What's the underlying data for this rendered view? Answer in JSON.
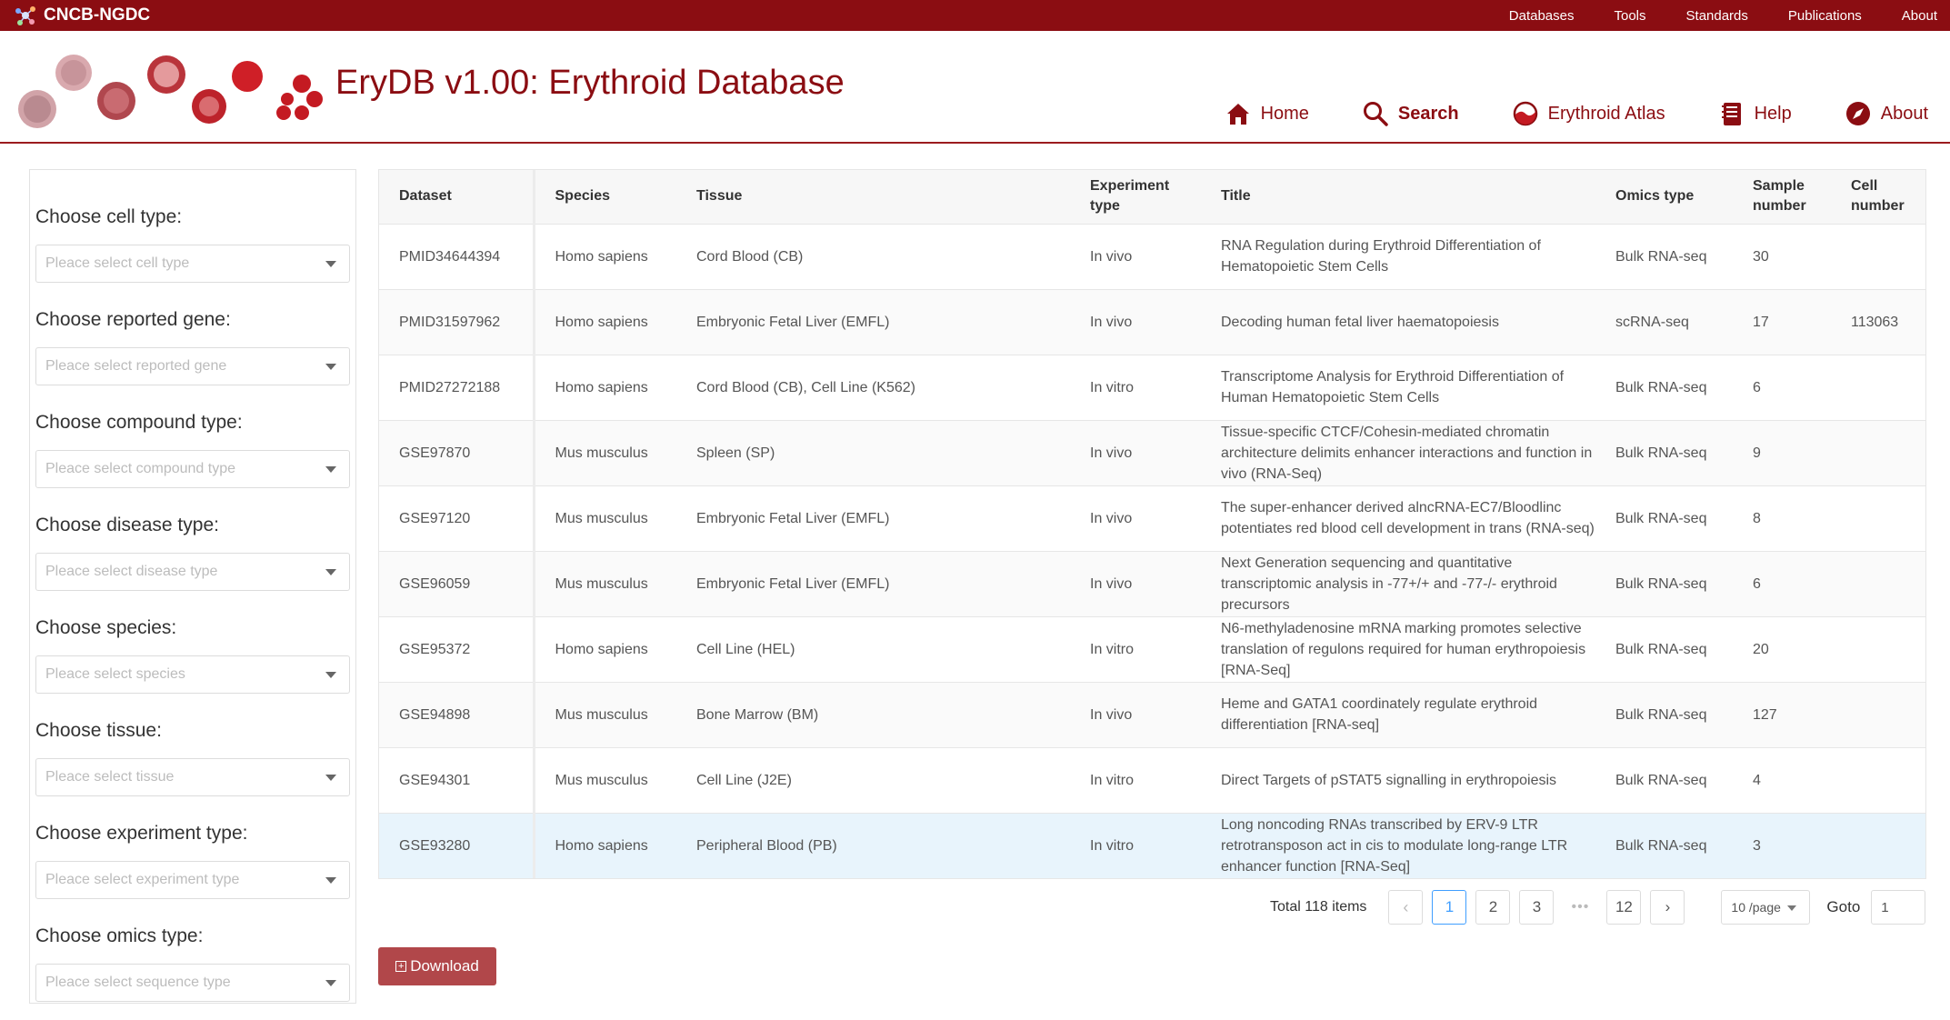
{
  "topbar": {
    "brand": "CNCB-NGDC",
    "nav": [
      "Databases",
      "Tools",
      "Standards",
      "Publications",
      "About"
    ]
  },
  "header": {
    "title": "EryDB v1.00: Erythroid Database",
    "nav": [
      {
        "label": "Home",
        "icon": "home-icon"
      },
      {
        "label": "Search",
        "icon": "search-icon"
      },
      {
        "label": "Erythroid Atlas",
        "icon": "atlas-icon"
      },
      {
        "label": "Help",
        "icon": "book-icon"
      },
      {
        "label": "About",
        "icon": "compass-icon"
      }
    ]
  },
  "filters": [
    {
      "label": "Choose cell type:",
      "placeholder": "Pleace select cell type"
    },
    {
      "label": "Choose reported gene:",
      "placeholder": "Pleace select reported gene"
    },
    {
      "label": "Choose compound type:",
      "placeholder": "Pleace select compound type"
    },
    {
      "label": "Choose disease type:",
      "placeholder": "Pleace select disease type"
    },
    {
      "label": "Choose species:",
      "placeholder": "Pleace select species"
    },
    {
      "label": "Choose tissue:",
      "placeholder": "Pleace select tissue"
    },
    {
      "label": "Choose experiment type:",
      "placeholder": "Pleace select experiment type"
    },
    {
      "label": "Choose omics type:",
      "placeholder": "Pleace select sequence type"
    }
  ],
  "table": {
    "headers": [
      "Dataset",
      "Species",
      "Tissue",
      "Experiment type",
      "Title",
      "Omics type",
      "Sample number",
      "Cell number"
    ],
    "rows": [
      [
        "PMID34644394",
        "Homo sapiens",
        "Cord Blood (CB)",
        "In vivo",
        "RNA Regulation during Erythroid Differentiation of Hematopoietic Stem Cells",
        "Bulk RNA-seq",
        "30",
        ""
      ],
      [
        "PMID31597962",
        "Homo sapiens",
        "Embryonic Fetal Liver (EMFL)",
        "In vivo",
        "Decoding human fetal liver haematopoiesis",
        "scRNA-seq",
        "17",
        "113063"
      ],
      [
        "PMID27272188",
        "Homo sapiens",
        "Cord Blood (CB), Cell Line (K562)",
        "In vitro",
        "Transcriptome Analysis for Erythroid Differentiation of Human Hematopoietic Stem Cells",
        "Bulk RNA-seq",
        "6",
        ""
      ],
      [
        "GSE97870",
        "Mus musculus",
        "Spleen (SP)",
        "In vivo",
        "Tissue-specific CTCF/Cohesin-mediated chromatin architecture delimits enhancer interactions and function in vivo (RNA-Seq)",
        "Bulk RNA-seq",
        "9",
        ""
      ],
      [
        "GSE97120",
        "Mus musculus",
        "Embryonic Fetal Liver (EMFL)",
        "In vivo",
        "The super-enhancer derived alncRNA-EC7/Bloodlinc potentiates red blood cell development in trans (RNA-seq)",
        "Bulk RNA-seq",
        "8",
        ""
      ],
      [
        "GSE96059",
        "Mus musculus",
        "Embryonic Fetal Liver (EMFL)",
        "In vivo",
        "Next Generation sequencing and quantitative transcriptomic analysis in -77+/+ and -77-/- erythroid precursors",
        "Bulk RNA-seq",
        "6",
        ""
      ],
      [
        "GSE95372",
        "Homo sapiens",
        "Cell Line (HEL)",
        "In vitro",
        "N6-methyladenosine mRNA marking promotes selective translation of regulons required for human erythropoiesis [RNA-Seq]",
        "Bulk RNA-seq",
        "20",
        ""
      ],
      [
        "GSE94898",
        "Mus musculus",
        "Bone Marrow (BM)",
        "In vivo",
        "Heme and GATA1 coordinately regulate erythroid differentiation [RNA-seq]",
        "Bulk RNA-seq",
        "127",
        ""
      ],
      [
        "GSE94301",
        "Mus musculus",
        "Cell Line (J2E)",
        "In vitro",
        "Direct Targets of pSTAT5 signalling in erythropoiesis",
        "Bulk RNA-seq",
        "4",
        ""
      ],
      [
        "GSE93280",
        "Homo sapiens",
        "Peripheral Blood (PB)",
        "In vitro",
        "Long noncoding RNAs transcribed by ERV-9 LTR retrotransposon act in cis to modulate long-range LTR enhancer function [RNA-Seq]",
        "Bulk RNA-seq",
        "3",
        ""
      ]
    ]
  },
  "pagination": {
    "total": "Total 118 items",
    "pages": [
      "1",
      "2",
      "3",
      "12"
    ],
    "current": "1",
    "ellipsis": "•••",
    "page_size": "10 /page",
    "goto_label": "Goto",
    "goto_value": "1"
  },
  "download_label": "Download",
  "colors": {
    "brand": "#8b0d12",
    "button": "#b1474a",
    "active": "#409eff",
    "highlight_row": "#e8f4fc"
  }
}
